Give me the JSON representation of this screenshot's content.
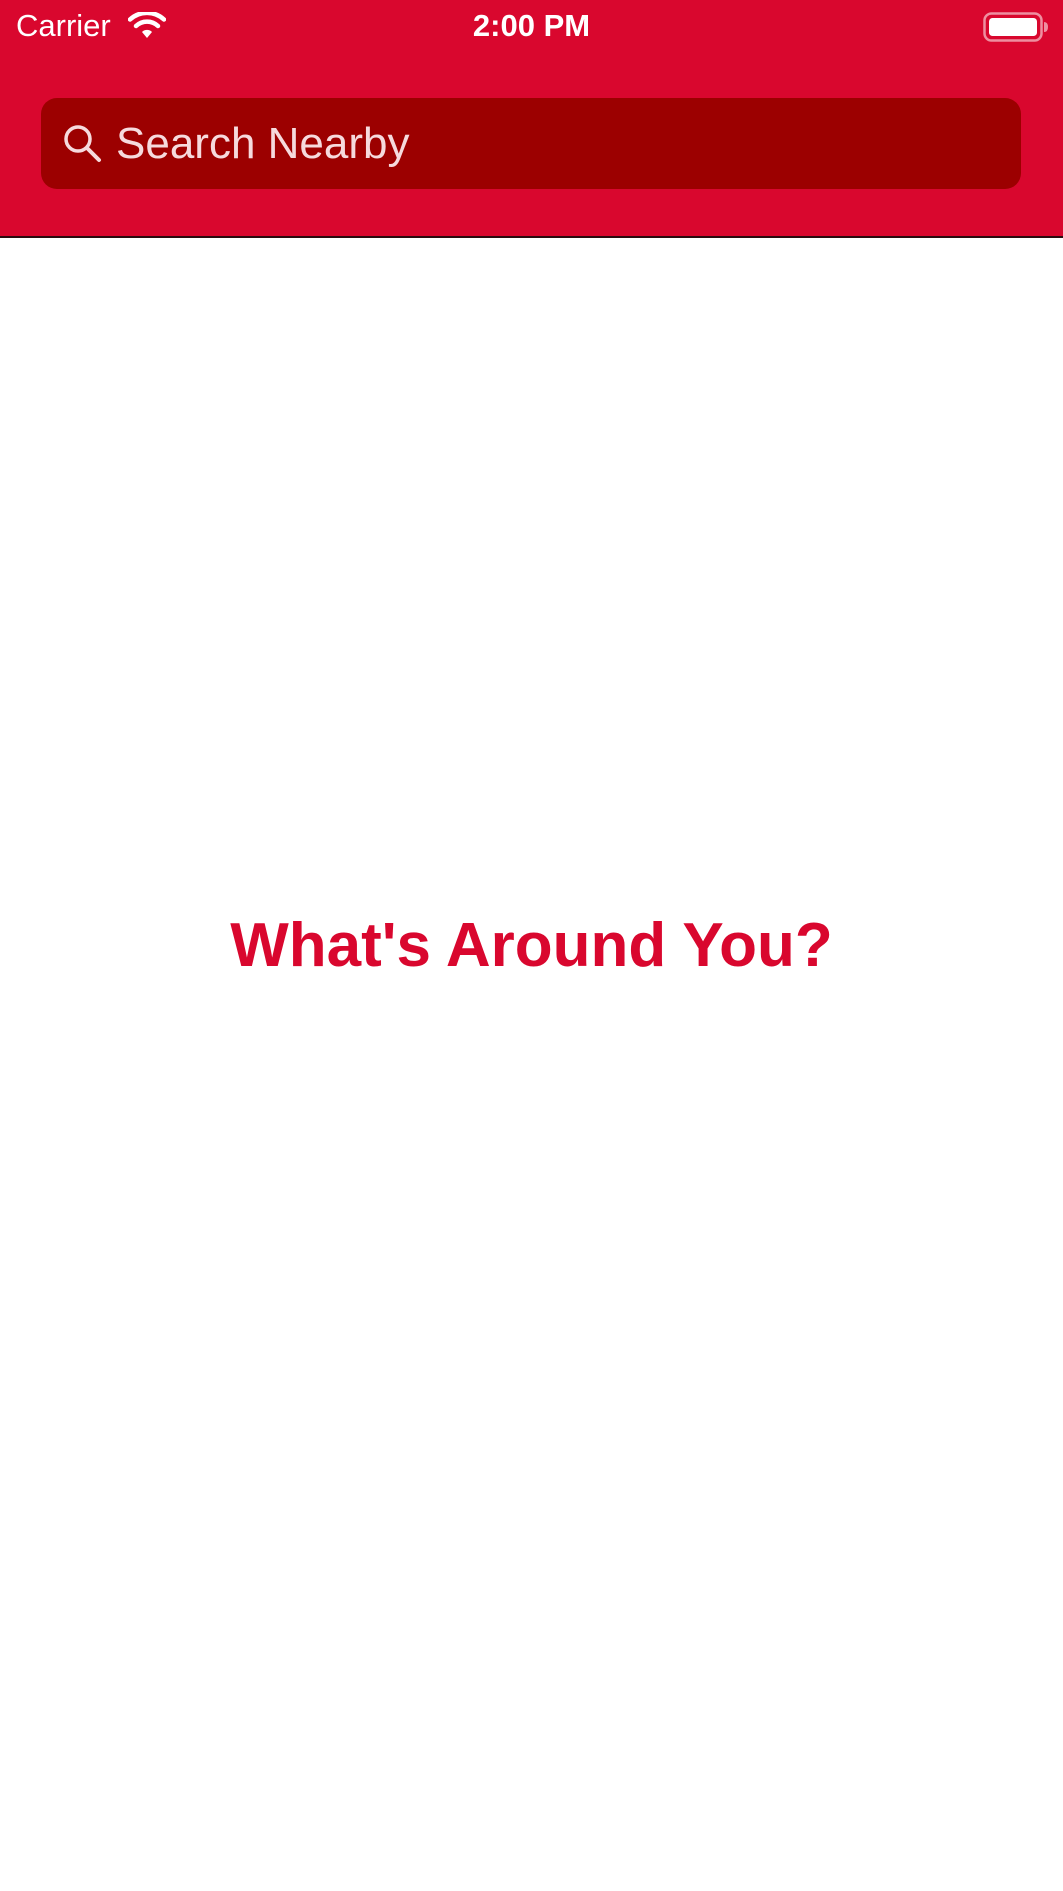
{
  "status_bar": {
    "carrier": "Carrier",
    "time": "2:00 PM",
    "wifi_icon": "wifi-icon",
    "battery_icon": "battery-icon"
  },
  "search": {
    "placeholder": "Search Nearby",
    "icon": "search-icon"
  },
  "main": {
    "title": "What's Around You?"
  },
  "colors": {
    "brand_red": "#d9072e",
    "search_field_bg": "#9c0000",
    "background": "#ffffff"
  }
}
